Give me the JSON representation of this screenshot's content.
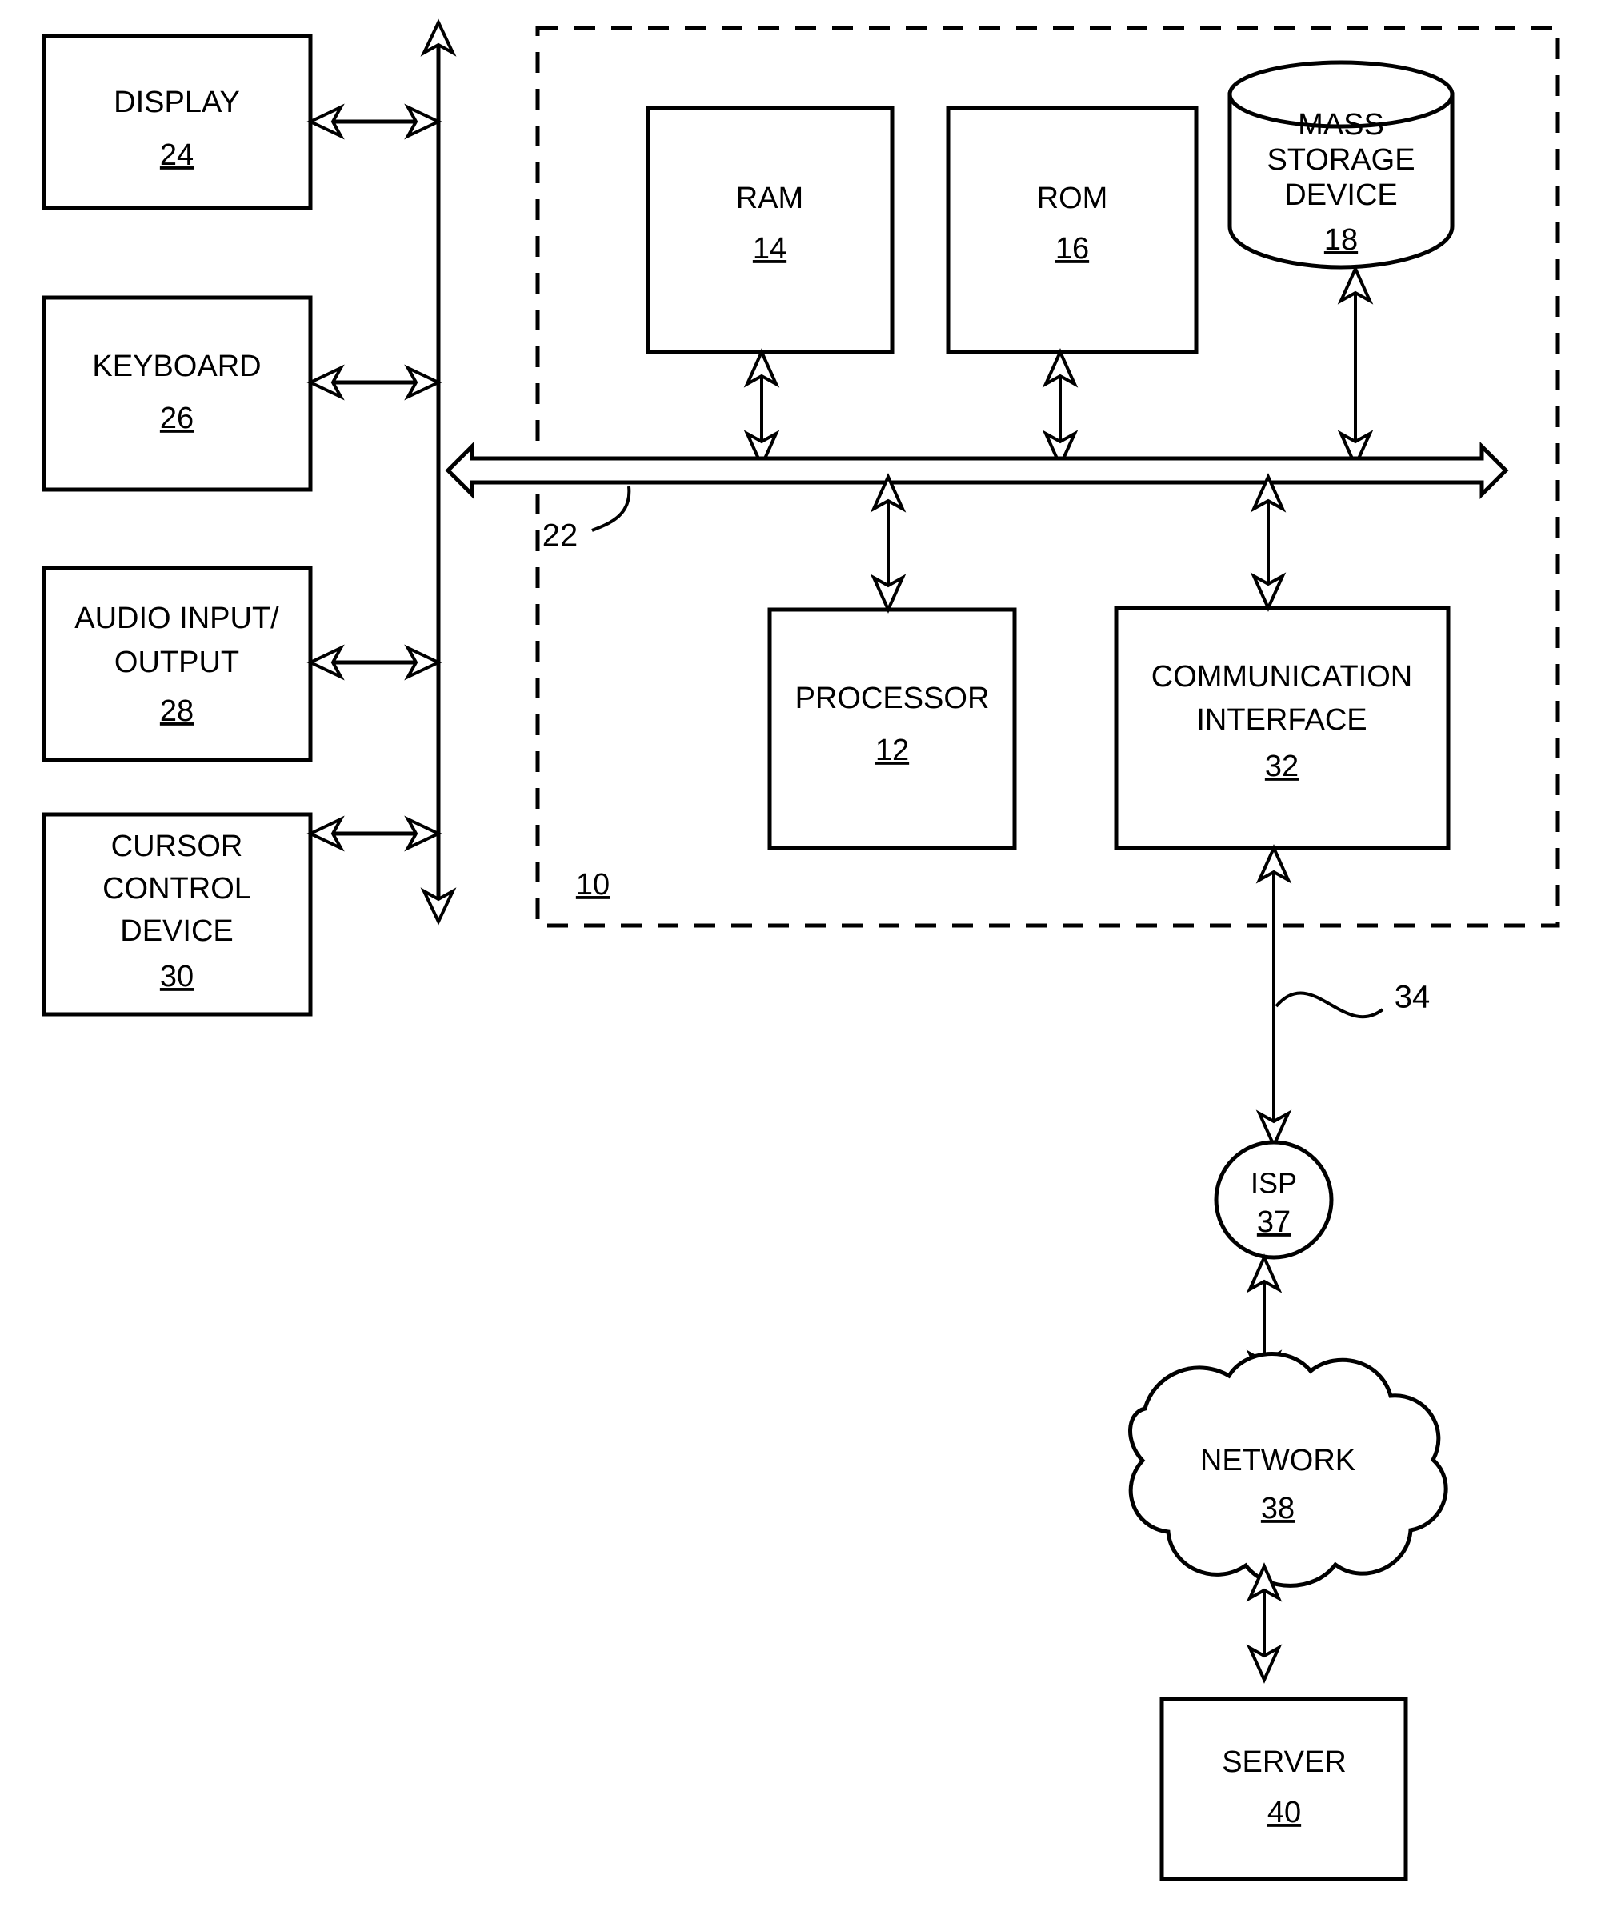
{
  "figure": {
    "type": "patent-system-block-diagram",
    "background_color": "#ffffff",
    "line_color": "#000000"
  },
  "peripherals": [
    {
      "label_line1": "DISPLAY",
      "label_line2": "",
      "label_line3": "",
      "ref": "24"
    },
    {
      "label_line1": "KEYBOARD",
      "label_line2": "",
      "label_line3": "",
      "ref": "26"
    },
    {
      "label_line1": "AUDIO INPUT/",
      "label_line2": "OUTPUT",
      "label_line3": "",
      "ref": "28"
    },
    {
      "label_line1": "CURSOR",
      "label_line2": "CONTROL",
      "label_line3": "DEVICE",
      "ref": "30"
    }
  ],
  "memory_blocks": [
    {
      "label": "RAM",
      "ref": "14",
      "shape": "rect"
    },
    {
      "label": "ROM",
      "ref": "16",
      "shape": "rect"
    }
  ],
  "storage": {
    "label_line1": "MASS",
    "label_line2": "STORAGE",
    "label_line3": "DEVICE",
    "ref": "18",
    "shape": "cylinder"
  },
  "core_blocks": [
    {
      "label_line1": "PROCESSOR",
      "label_line2": "",
      "ref": "12",
      "shape": "rect"
    },
    {
      "label_line1": "COMMUNICATION",
      "label_line2": "INTERFACE",
      "ref": "32",
      "shape": "rect"
    }
  ],
  "bus": {
    "ref": "22",
    "name": "system-bus"
  },
  "computer_system": {
    "ref": "10",
    "name": "computer-system-boundary",
    "boundary_style": "dashed"
  },
  "external_link": {
    "ref": "34",
    "name": "communication-link"
  },
  "network_nodes": [
    {
      "label": "ISP",
      "ref": "37",
      "shape": "circle"
    },
    {
      "label": "NETWORK",
      "ref": "38",
      "shape": "cloud"
    },
    {
      "label": "SERVER",
      "ref": "40",
      "shape": "rect"
    }
  ]
}
